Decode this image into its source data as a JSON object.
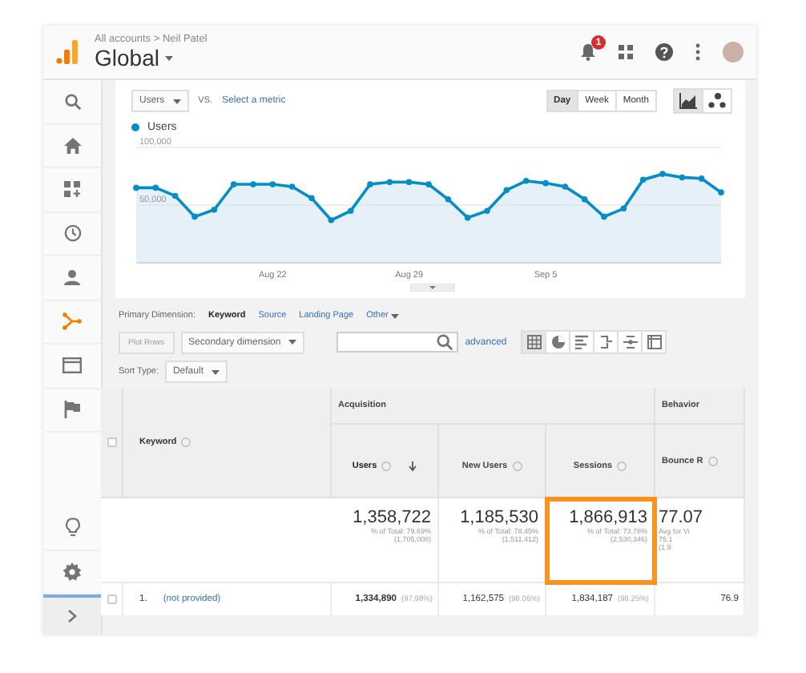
{
  "header": {
    "breadcrumb": "All accounts > Neil Patel",
    "title": "Global",
    "notification_count": "1"
  },
  "sidebar": {
    "items": [
      {
        "kind": "search",
        "selected": false
      },
      {
        "kind": "home",
        "selected": false
      },
      {
        "kind": "dashboard",
        "selected": false
      },
      {
        "kind": "clock",
        "selected": false
      },
      {
        "kind": "person",
        "selected": false
      },
      {
        "kind": "branch",
        "selected": true
      },
      {
        "kind": "window",
        "selected": false
      },
      {
        "kind": "flag",
        "selected": false
      }
    ],
    "bottom": [
      {
        "kind": "bulb"
      },
      {
        "kind": "gear"
      },
      {
        "kind": "chevron"
      }
    ]
  },
  "chart_controls": {
    "metric": "Users",
    "vs": "VS.",
    "compare_link": "Select a metric",
    "periods": [
      {
        "label": "Day",
        "selected": true
      },
      {
        "label": "Week",
        "selected": false
      },
      {
        "label": "Month",
        "selected": false
      }
    ],
    "chart_types": [
      {
        "kind": "line",
        "selected": true
      },
      {
        "kind": "motion",
        "selected": false
      }
    ]
  },
  "chart_data": {
    "type": "area",
    "categories": [
      null,
      null,
      null,
      null,
      null,
      null,
      null,
      "Aug 22",
      null,
      null,
      null,
      null,
      null,
      null,
      "Aug 29",
      null,
      null,
      null,
      null,
      null,
      null,
      "Sep 5",
      null,
      null,
      null,
      null,
      null,
      null,
      null,
      null,
      null
    ],
    "series": [
      {
        "name": "Users",
        "color": "#058dc7",
        "values": [
          65000,
          65000,
          58000,
          40000,
          46000,
          68000,
          68000,
          68000,
          66000,
          56000,
          37000,
          45000,
          68000,
          70000,
          70000,
          68000,
          55000,
          39000,
          45000,
          63000,
          71000,
          69000,
          66000,
          55000,
          40000,
          47000,
          72000,
          77000,
          74000,
          73000,
          61000
        ]
      }
    ],
    "ylim": [
      0,
      100000
    ],
    "yticks": [
      {
        "value": 50000,
        "label": "50,000"
      },
      {
        "value": 100000,
        "label": "100,000"
      }
    ]
  },
  "dimensions": {
    "label": "Primary Dimension:",
    "items": [
      {
        "label": "Keyword",
        "selected": true
      },
      {
        "label": "Source",
        "selected": false
      },
      {
        "label": "Landing Page",
        "selected": false
      },
      {
        "label": "Other",
        "selected": false
      }
    ]
  },
  "toolbar": {
    "plot_rows": {
      "label": "Plot Rows",
      "disabled": true
    },
    "secondary": "Secondary dimension",
    "advanced": "advanced",
    "views": [
      {
        "kind": "table",
        "selected": true
      },
      {
        "kind": "pie",
        "selected": false
      },
      {
        "kind": "bars",
        "selected": false
      },
      {
        "kind": "compare",
        "selected": false
      },
      {
        "kind": "term-cloud",
        "selected": false
      },
      {
        "kind": "pivot",
        "selected": false
      }
    ]
  },
  "sort": {
    "label": "Sort Type:",
    "value": "Default"
  },
  "table": {
    "all_checked": false,
    "key_column": "Keyword",
    "groups": [
      {
        "label": "Acquisition"
      },
      {
        "label": "Behavior"
      }
    ],
    "columns": [
      {
        "label": "Users",
        "sorted": true
      },
      {
        "label": "New Users",
        "sorted": false
      },
      {
        "label": "Sessions",
        "sorted": false
      },
      {
        "label": "Bounce R",
        "sorted": false
      }
    ],
    "totals": [
      {
        "value": "1,358,722",
        "notes": [
          "% of Total: 79.69%",
          "(1,705,008)"
        ],
        "highlighted": false
      },
      {
        "value": "1,185,530",
        "notes": [
          "% of Total: 78.45%",
          "(1,511,412)"
        ],
        "highlighted": false
      },
      {
        "value": "1,866,913",
        "notes": [
          "% of Total: 73.78%",
          "(2,530,346)"
        ],
        "highlighted": true
      },
      {
        "value": "77.07",
        "notes": [
          "Avg for Vi",
          "75.1",
          "(1.9"
        ],
        "highlighted": false
      }
    ],
    "rows": [
      {
        "index": "1.",
        "keyword": "(not provided)",
        "checked": false,
        "cells": [
          {
            "value": "1,334,890",
            "share": "(97.98%)"
          },
          {
            "value": "1,162,575",
            "share": "(98.06%)"
          },
          {
            "value": "1,834,187",
            "share": "(98.25%)"
          },
          {
            "value": "76.9"
          }
        ]
      }
    ]
  }
}
